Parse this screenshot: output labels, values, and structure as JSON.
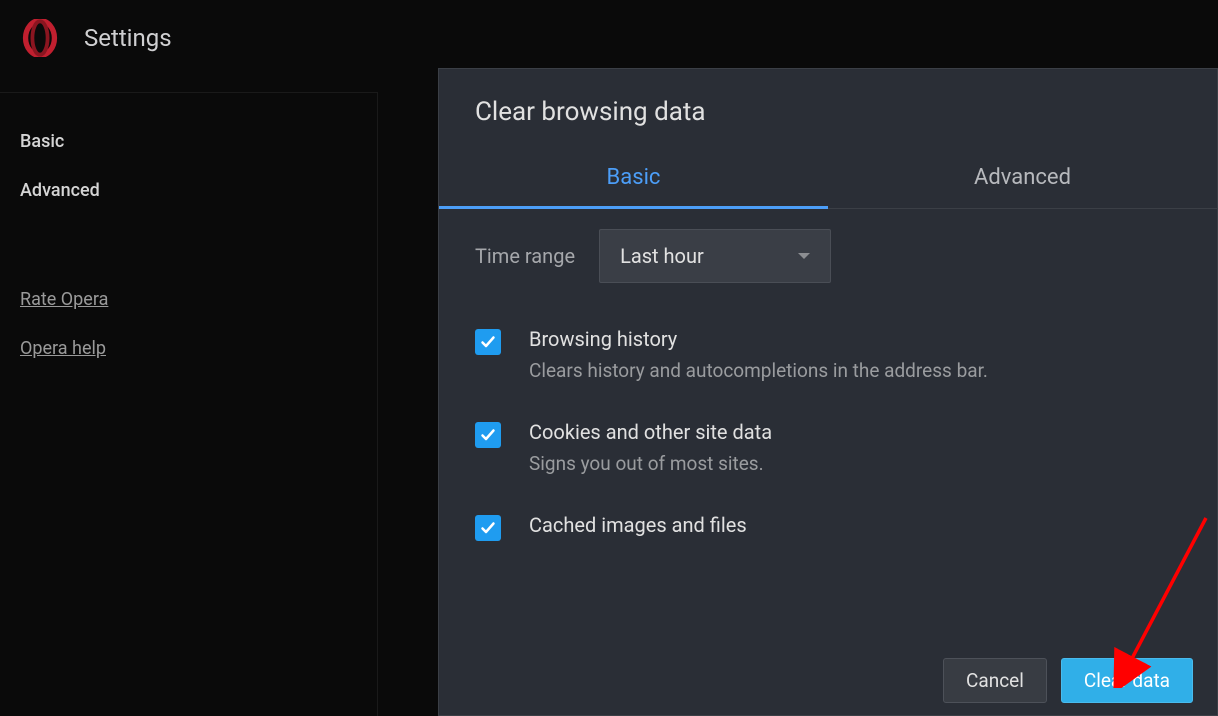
{
  "header": {
    "title": "Settings"
  },
  "sidebar": {
    "items": [
      {
        "label": "Basic"
      },
      {
        "label": "Advanced"
      }
    ],
    "links": [
      {
        "label": "Rate Opera"
      },
      {
        "label": "Opera help"
      }
    ]
  },
  "dialog": {
    "title": "Clear browsing data",
    "tabs": [
      {
        "label": "Basic",
        "active": true
      },
      {
        "label": "Advanced",
        "active": false
      }
    ],
    "time_range": {
      "label": "Time range",
      "value": "Last hour"
    },
    "options": [
      {
        "title": "Browsing history",
        "desc": "Clears history and autocompletions in the address bar.",
        "checked": true
      },
      {
        "title": "Cookies and other site data",
        "desc": "Signs you out of most sites.",
        "checked": true
      },
      {
        "title": "Cached images and files",
        "desc": "",
        "checked": true
      }
    ],
    "footer": {
      "cancel": "Cancel",
      "confirm": "Clear data"
    }
  }
}
